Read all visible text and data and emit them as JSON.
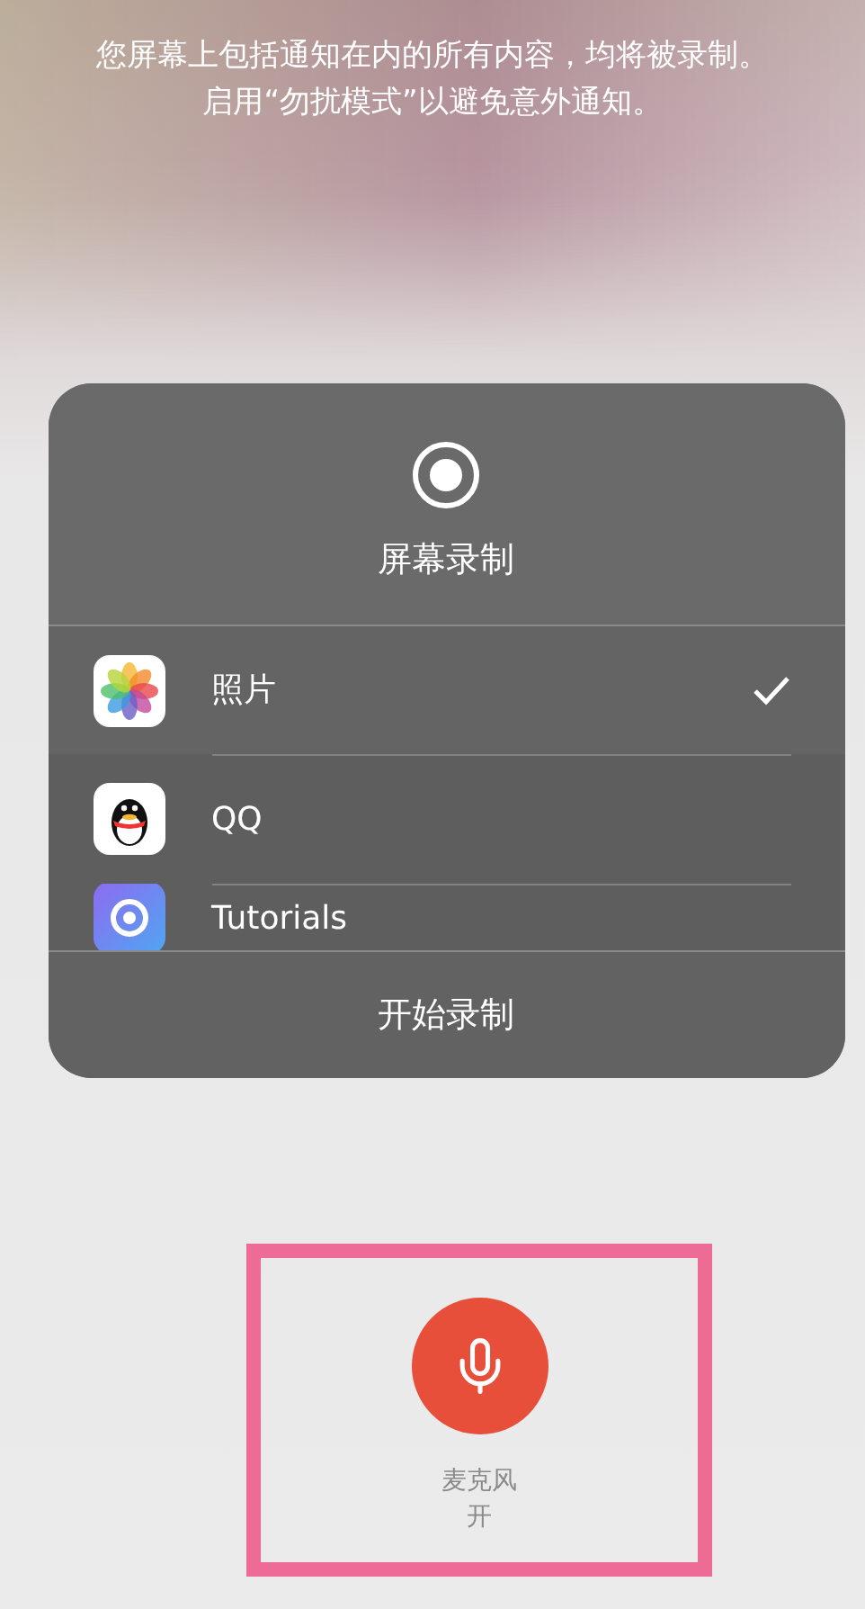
{
  "notice": "您屏幕上包括通知在内的所有内容，均将被录制。启用“勿扰模式”以避免意外通知。",
  "panel": {
    "title": "屏幕录制",
    "apps": [
      {
        "kind": "photos",
        "name": "照片",
        "selected": true
      },
      {
        "kind": "qq",
        "name": "QQ",
        "selected": false
      },
      {
        "kind": "tutorials",
        "name": "Tutorials",
        "selected": false
      }
    ],
    "start_button": "开始录制"
  },
  "microphone": {
    "label": "麦克风",
    "state": "开",
    "on": true,
    "highlighted": true
  }
}
